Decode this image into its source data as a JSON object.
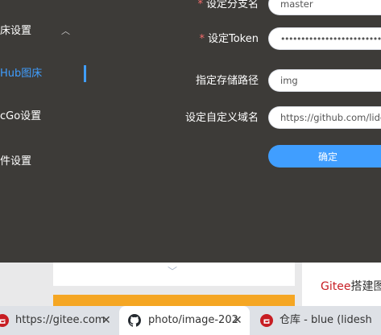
{
  "sidebar": {
    "items": [
      {
        "label": "床设置"
      },
      {
        "label": "Hub图床"
      },
      {
        "label": "cGo设置"
      },
      {
        "label": "件设置"
      }
    ]
  },
  "form": {
    "branch": {
      "label": "设定分支名",
      "value": "master"
    },
    "token": {
      "label": "设定Token",
      "value": "••••••••••••••••••••••••••••••••••••••••"
    },
    "path": {
      "label": "指定存储路径",
      "value": "img"
    },
    "domain": {
      "label": "设定自定义域名",
      "value": "https://github.com/lidesh"
    },
    "confirm_label": "确定"
  },
  "page": {
    "gitee_brand": "Gitee",
    "gitee_rest": "搭建图"
  },
  "tabs": [
    {
      "title": "https://gitee.com",
      "icon": "gitee-icon"
    },
    {
      "title": "photo/image-202",
      "icon": "github-icon"
    },
    {
      "title": "仓库 - blue (lidesh",
      "icon": "gitee-icon"
    }
  ],
  "colors": {
    "panel_bg": "#3d3b38",
    "accent": "#409eff",
    "required": "#f56c6c",
    "gitee_red": "#c71d23",
    "tab_strip": "#dee1e6"
  }
}
